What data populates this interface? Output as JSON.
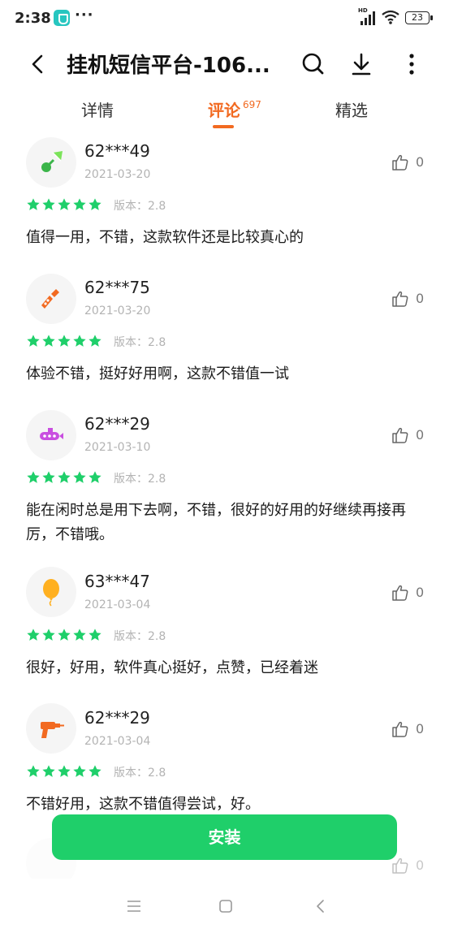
{
  "status": {
    "time": "2:38",
    "dots": "···",
    "battery": "23",
    "hd": "HD"
  },
  "header": {
    "title": "挂机短信平台-106...",
    "back_icon": "chevron-left-icon",
    "search_icon": "search-icon",
    "download_icon": "download-icon",
    "more_icon": "more-vertical-icon"
  },
  "tabs": [
    {
      "label": "详情"
    },
    {
      "label": "评论",
      "count": "697"
    },
    {
      "label": "精选"
    }
  ],
  "colors": {
    "accent": "#f26a21",
    "star": "#1fcf6a",
    "install": "#1fcf6a"
  },
  "reviews": [
    {
      "user": "62***49",
      "date": "2021-03-20",
      "likes": "0",
      "rating": 5,
      "version": "版本：2.8",
      "text": "值得一用，不错，这款软件还是比较真心的",
      "avatar_icon": "badminton-icon"
    },
    {
      "user": "62***75",
      "date": "2021-03-20",
      "likes": "0",
      "rating": 5,
      "version": "版本：2.8",
      "text": "体验不错，挺好好用啊，这款不错值一试",
      "avatar_icon": "screwdriver-icon"
    },
    {
      "user": "62***29",
      "date": "2021-03-10",
      "likes": "0",
      "rating": 5,
      "version": "版本：2.8",
      "text": "能在闲时总是用下去啊，不错，很好的好用的好继续再接再厉，不错哦。",
      "avatar_icon": "submarine-icon"
    },
    {
      "user": "63***47",
      "date": "2021-03-04",
      "likes": "0",
      "rating": 5,
      "version": "版本：2.8",
      "text": "很好，好用，软件真心挺好，点赞，已经着迷",
      "avatar_icon": "balloon-icon"
    },
    {
      "user": "62***29",
      "date": "2021-03-04",
      "likes": "0",
      "rating": 5,
      "version": "版本：2.8",
      "text": "不错好用，这款不错值得尝试，好。",
      "avatar_icon": "drill-icon"
    }
  ],
  "partial_review": {
    "likes": "0"
  },
  "install": {
    "label": "安装"
  },
  "nav": {
    "menu_icon": "menu-icon",
    "home_icon": "home-icon",
    "back_icon": "back-icon"
  }
}
